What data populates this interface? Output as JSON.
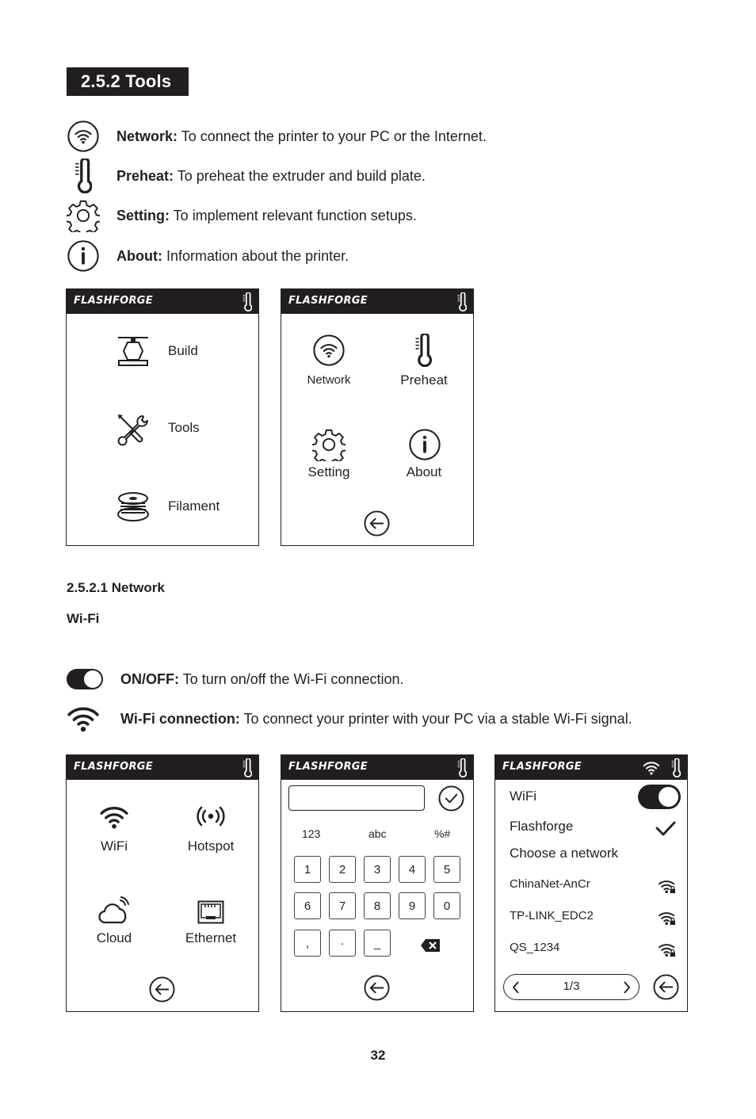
{
  "section": {
    "title": "2.5.2 Tools",
    "items": [
      {
        "icon": "wifi-circle-icon",
        "label": "Network:",
        "text": " To connect the printer to your PC or the Internet."
      },
      {
        "icon": "thermometer-icon",
        "label": "Preheat:",
        "text": " To preheat the extruder and build plate."
      },
      {
        "icon": "gear-icon",
        "label": "Setting:",
        "text": " To implement relevant function setups."
      },
      {
        "icon": "info-icon",
        "label": "About:",
        "text": " Information about the printer."
      }
    ]
  },
  "brand": "FLASHFORGE",
  "screens": {
    "main": {
      "items": [
        {
          "icon": "build-icon",
          "label": "Build"
        },
        {
          "icon": "tools-icon",
          "label": "Tools"
        },
        {
          "icon": "filament-icon",
          "label": "Filament"
        }
      ]
    },
    "tools": {
      "items": [
        {
          "icon": "wifi-circle-icon",
          "label": "Network"
        },
        {
          "icon": "thermometer-icon",
          "label": "Preheat"
        },
        {
          "icon": "gear-icon",
          "label": "Setting"
        },
        {
          "icon": "info-icon",
          "label": "About"
        }
      ]
    },
    "network": {
      "items": [
        {
          "icon": "wifi-icon",
          "label": "WiFi"
        },
        {
          "icon": "hotspot-icon",
          "label": "Hotspot"
        },
        {
          "icon": "cloud-icon",
          "label": "Cloud"
        },
        {
          "icon": "ethernet-icon",
          "label": "Ethernet"
        }
      ]
    },
    "keyboard": {
      "input_value": "",
      "tabs": [
        "123",
        "abc",
        "%#"
      ],
      "rows": [
        [
          "1",
          "2",
          "3",
          "4",
          "5"
        ],
        [
          "6",
          "7",
          "8",
          "9",
          "0"
        ],
        [
          ",",
          "·",
          "_"
        ]
      ]
    },
    "wifi_list": {
      "wifi_label": "WiFi",
      "wifi_on": true,
      "connected": "Flashforge",
      "choose_label": "Choose a network",
      "networks": [
        "ChinaNet-AnCr",
        "TP-LINK_EDC2",
        "QS_1234"
      ],
      "page": "1/3"
    }
  },
  "subsection": {
    "title": "2.5.2.1 Network",
    "subtitle": "Wi-Fi",
    "items": [
      {
        "icon": "toggle-icon",
        "label": "ON/OFF:",
        "text": " To turn on/off the Wi-Fi connection."
      },
      {
        "icon": "wifi-icon",
        "label": "Wi-Fi connection:",
        "text": " To connect your printer with your PC via a stable Wi-Fi signal."
      }
    ]
  },
  "page_number": "32"
}
